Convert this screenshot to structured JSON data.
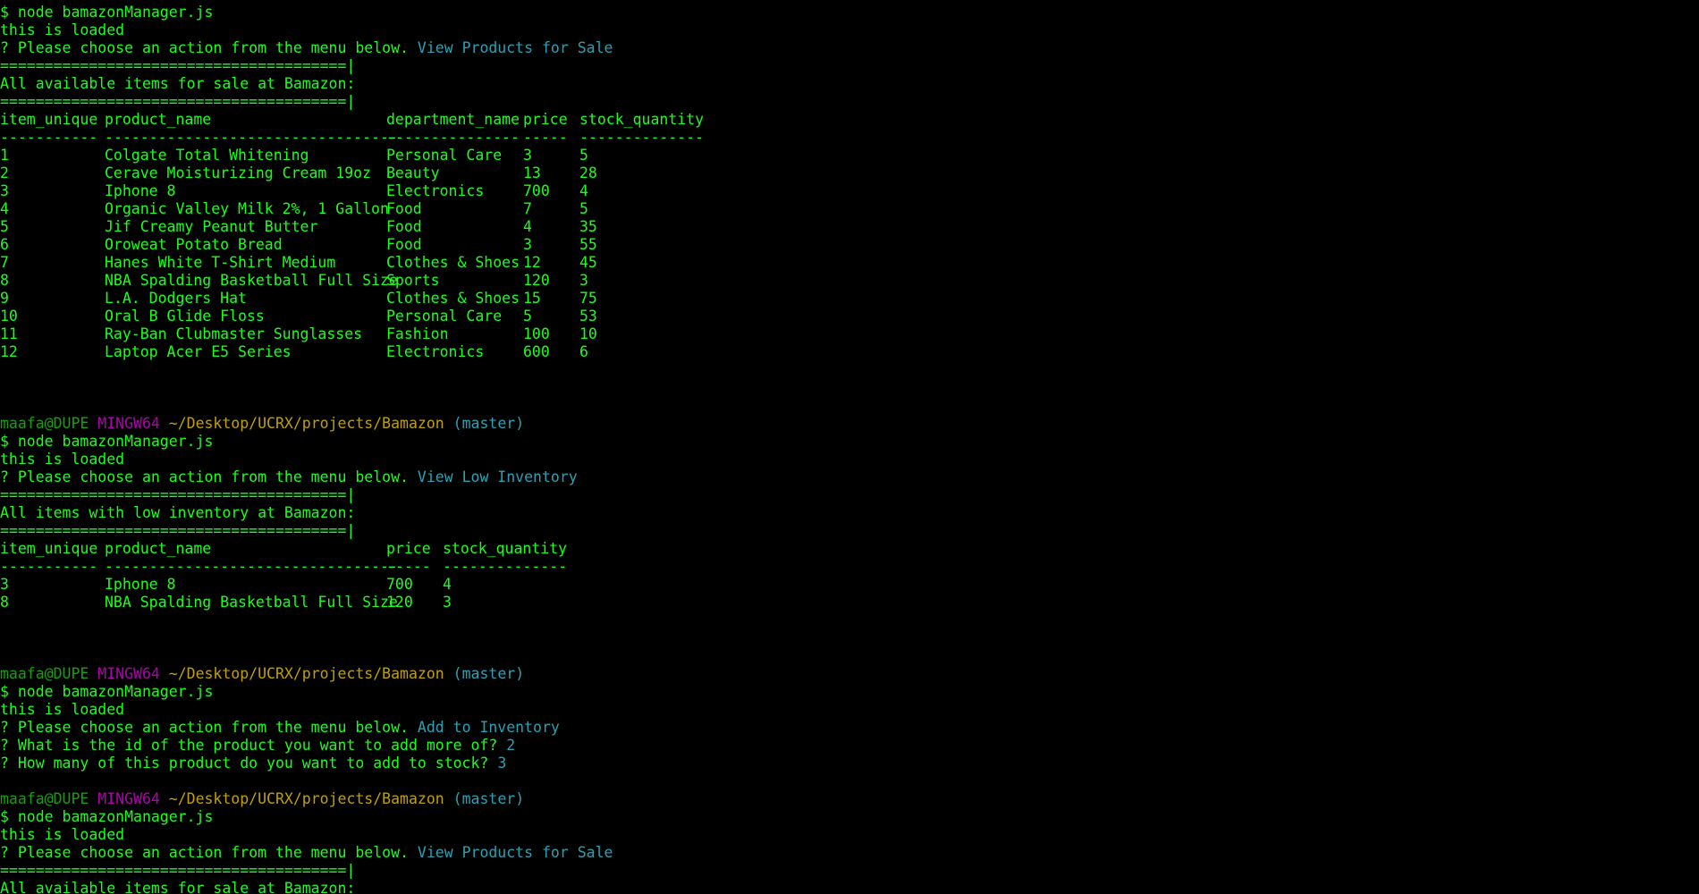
{
  "colors": {
    "background": "#000000",
    "output_text": "#1aff1a",
    "selected_answer": "#2aa1b3",
    "prompt_user": "#13a10e",
    "prompt_mingw": "#b000b0",
    "prompt_path": "#c1a000",
    "prompt_branch": "#2aa1b3"
  },
  "prompt": {
    "user_host": "maafa@DUPE",
    "env": "MINGW64",
    "path": "~/Desktop/UCRX/projects/Bamazon",
    "branch": "(master)"
  },
  "session1": {
    "command": "$ node bamazonManager.js",
    "loaded": "this is loaded",
    "question": "? Please choose an action from the menu below.",
    "answer": "View Products for Sale",
    "separator_top": "=======================================|",
    "heading": "All available items for sale at Bamazon:",
    "separator_bottom": "=======================================|",
    "table": {
      "headers": [
        "item_unique",
        "product_name",
        "department_name",
        "price",
        "stock_quantity"
      ],
      "underlines": [
        "-----------",
        "---------------------------------",
        "---------------",
        "-----",
        "--------------"
      ],
      "rows": [
        [
          "1",
          "Colgate Total Whitening",
          "Personal Care",
          "3",
          "5"
        ],
        [
          "2",
          "Cerave Moisturizing Cream 19oz",
          "Beauty",
          "13",
          "28"
        ],
        [
          "3",
          "Iphone 8",
          "Electronics",
          "700",
          "4"
        ],
        [
          "4",
          "Organic Valley Milk 2%, 1 Gallon",
          "Food",
          "7",
          "5"
        ],
        [
          "5",
          "Jif Creamy Peanut Butter",
          "Food",
          "4",
          "35"
        ],
        [
          "6",
          "Oroweat Potato Bread",
          "Food",
          "3",
          "55"
        ],
        [
          "7",
          "Hanes White T-Shirt Medium",
          "Clothes & Shoes",
          "12",
          "45"
        ],
        [
          "8",
          "NBA Spalding Basketball Full Size",
          "Sports",
          "120",
          "3"
        ],
        [
          "9",
          "L.A. Dodgers Hat",
          "Clothes & Shoes",
          "15",
          "75"
        ],
        [
          "10",
          "Oral B Glide Floss",
          "Personal Care",
          "5",
          "53"
        ],
        [
          "11",
          "Ray-Ban Clubmaster Sunglasses",
          "Fashion",
          "100",
          "10"
        ],
        [
          "12",
          "Laptop Acer E5 Series",
          "Electronics",
          "600",
          "6"
        ]
      ]
    }
  },
  "session2": {
    "command": "$ node bamazonManager.js",
    "loaded": "this is loaded",
    "question": "? Please choose an action from the menu below.",
    "answer": "View Low Inventory",
    "separator_top": "=======================================|",
    "heading": "All items with low inventory at Bamazon:",
    "separator_bottom": "=======================================|",
    "table": {
      "headers": [
        "item_unique",
        "product_name",
        "price",
        "stock_quantity"
      ],
      "underlines": [
        "-----------",
        "---------------------------------",
        "-----",
        "--------------"
      ],
      "rows": [
        [
          "3",
          "Iphone 8",
          "700",
          "4"
        ],
        [
          "8",
          "NBA Spalding Basketball Full Size",
          "120",
          "3"
        ]
      ]
    }
  },
  "session3": {
    "command": "$ node bamazonManager.js",
    "loaded": "this is loaded",
    "question": "? Please choose an action from the menu below.",
    "answer": "Add to Inventory",
    "q2": "? What is the id of the product you want to add more of?",
    "a2": "2",
    "q3": "? How many of this product do you want to add to stock?",
    "a3": "3"
  },
  "session4": {
    "command": "$ node bamazonManager.js",
    "loaded": "this is loaded",
    "question": "? Please choose an action from the menu below.",
    "answer": "View Products for Sale",
    "separator_top": "=======================================|",
    "heading": "All available items for sale at Bamazon:"
  }
}
